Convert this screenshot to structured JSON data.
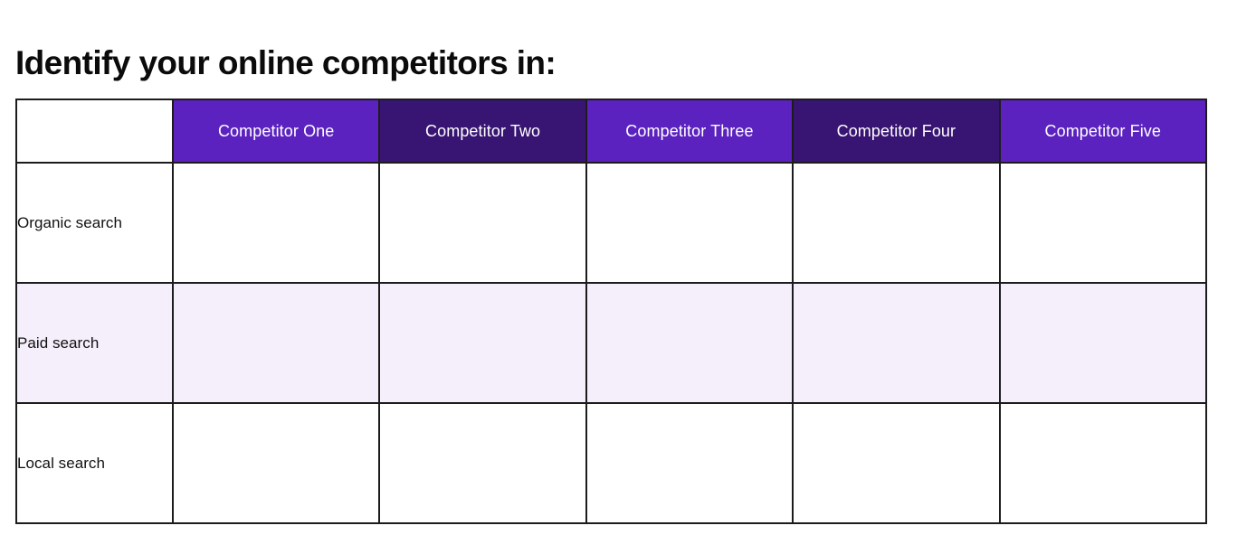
{
  "title": "Identify your online competitors in:",
  "colors": {
    "header_light_purple": "#5B22C0",
    "header_dark_purple": "#381572",
    "row_tint_lavender": "#F5EFFC",
    "border": "#1C1C1C",
    "title_text": "#0B0B0B",
    "header_text": "#FFFFFF",
    "body_text": "#111111"
  },
  "table": {
    "corner_label": "",
    "columns": [
      {
        "label": "Competitor One",
        "shade": "light"
      },
      {
        "label": "Competitor Two",
        "shade": "dark"
      },
      {
        "label": "Competitor Three",
        "shade": "light"
      },
      {
        "label": "Competitor Four",
        "shade": "dark"
      },
      {
        "label": "Competitor Five",
        "shade": "light"
      }
    ],
    "rows": [
      {
        "label": "Organic search",
        "tint": false,
        "cells": [
          "",
          "",
          "",
          "",
          ""
        ]
      },
      {
        "label": "Paid search",
        "tint": true,
        "cells": [
          "",
          "",
          "",
          "",
          ""
        ]
      },
      {
        "label": "Local search",
        "tint": false,
        "cells": [
          "",
          "",
          "",
          "",
          ""
        ]
      }
    ]
  }
}
